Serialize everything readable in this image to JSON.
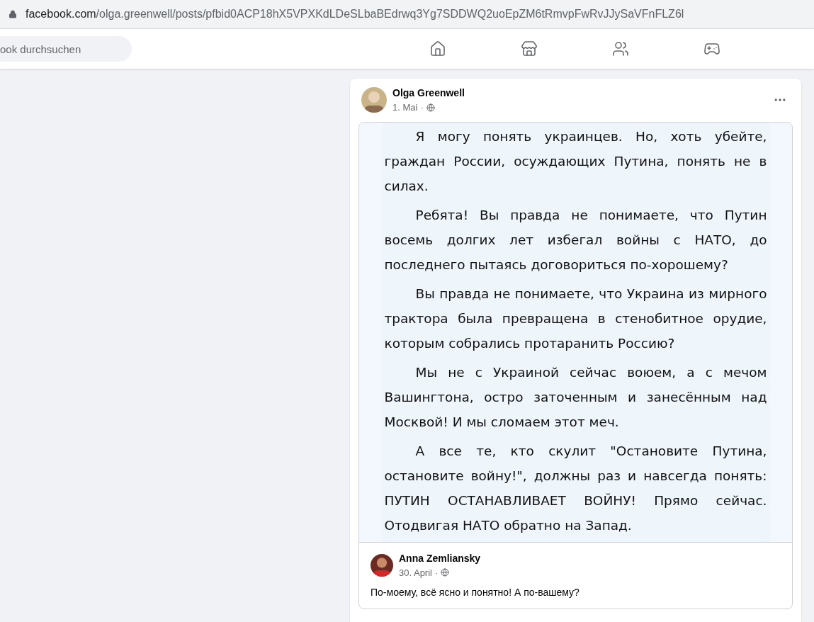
{
  "address_bar": {
    "domain": "facebook.com",
    "path": "/olga.greenwell/posts/pfbid0ACP18hX5VPXKdLDeSLbaBEdrwq3Yg7SDDWQ2uoEpZM6tRmvpFwRvJJySaVFnFLZ6l"
  },
  "nav": {
    "search": {
      "placeholder": "ook durchsuchen"
    },
    "tabs": [
      {
        "kind": "home",
        "selected": false
      },
      {
        "kind": "marketplace",
        "selected": false
      },
      {
        "kind": "groups",
        "selected": false
      },
      {
        "kind": "gaming",
        "selected": false
      }
    ]
  },
  "post": {
    "author": "Olga Greenwell",
    "date": "1. Mai",
    "separator": "·",
    "shared_image": {
      "paragraphs": [
        "Я могу понять украинцев. Но, хоть убейте, граждан России, осуждающих Путина, понять не в силах.",
        "Ребята! Вы правда не понимаете, что Путин восемь долгих лет избегал войны с НАТО, до последнего пытаясь договориться по-хорошему?",
        "Вы правда не понимаете, что Украина из мирного трактора была превращена в стенобитное орудие, которым собрались протаранить Россию?",
        "Мы не с Украиной сейчас воюем, а с мечом Вашингтона, остро заточенным и занесённым над Москвой! И мы сломаем этот меч.",
        "А все те, кто скулит \"Остановите Путина, остановите войну!\", должны раз и навсегда понять: ПУТИН ОСТАНАВЛИВАЕТ ВОЙНУ! Прямо сейчас. Отодвигая НАТО обратно на Запад."
      ]
    },
    "shared_post": {
      "author": "Anna Zemliansky",
      "date": "30. April",
      "separator": "·",
      "text": "По-моему, всё ясно и понятно! А по-вашему?"
    }
  }
}
